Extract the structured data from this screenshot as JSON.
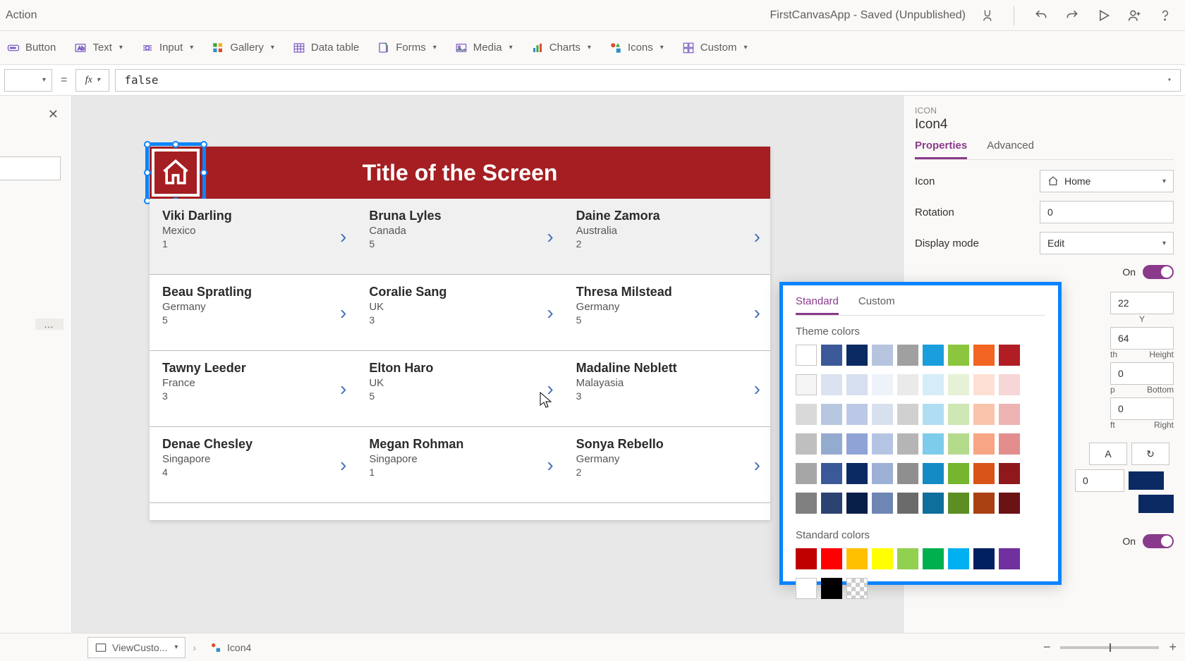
{
  "titlebar": {
    "action_label": "Action",
    "center_title": "FirstCanvasApp - Saved (Unpublished)"
  },
  "ribbon": {
    "button": "Button",
    "text": "Text",
    "input": "Input",
    "gallery": "Gallery",
    "datatable": "Data table",
    "forms": "Forms",
    "media": "Media",
    "charts": "Charts",
    "icons": "Icons",
    "custom": "Custom"
  },
  "formula": {
    "eq": "=",
    "fx": "fx",
    "value": "false"
  },
  "canvas": {
    "title": "Title of the Screen"
  },
  "gallery": [
    [
      {
        "name": "Viki Darling",
        "country": "Mexico",
        "num": "1"
      },
      {
        "name": "Bruna Lyles",
        "country": "Canada",
        "num": "5"
      },
      {
        "name": "Daine Zamora",
        "country": "Australia",
        "num": "2"
      }
    ],
    [
      {
        "name": "Beau Spratling",
        "country": "Germany",
        "num": "5"
      },
      {
        "name": "Coralie Sang",
        "country": "UK",
        "num": "3"
      },
      {
        "name": "Thresa Milstead",
        "country": "Germany",
        "num": "5"
      }
    ],
    [
      {
        "name": "Tawny Leeder",
        "country": "France",
        "num": "3"
      },
      {
        "name": "Elton Haro",
        "country": "UK",
        "num": "5"
      },
      {
        "name": "Madaline Neblett",
        "country": "Malayasia",
        "num": "3"
      }
    ],
    [
      {
        "name": "Denae Chesley",
        "country": "Singapore",
        "num": "4"
      },
      {
        "name": "Megan Rohman",
        "country": "Singapore",
        "num": "1"
      },
      {
        "name": "Sonya Rebello",
        "country": "Germany",
        "num": "2"
      }
    ]
  ],
  "panel": {
    "category": "ICON",
    "name": "Icon4",
    "tabs": {
      "properties": "Properties",
      "advanced": "Advanced"
    },
    "rows": {
      "icon_label": "Icon",
      "icon_value": "Home",
      "rotation_label": "Rotation",
      "rotation_value": "0",
      "display_mode_label": "Display mode",
      "display_mode_value": "Edit",
      "on_label": "On",
      "y_label": "Y",
      "y_value": "64",
      "x_value": "22",
      "height_label": "Height",
      "height_value": "0",
      "width_label": "th",
      "bottom_label": "Bottom",
      "bottom_value": "0",
      "top_label": "p",
      "left_label": "ft",
      "right_label": "Right",
      "num_value": "0"
    }
  },
  "colorpicker": {
    "tabs": {
      "standard": "Standard",
      "custom": "Custom"
    },
    "theme_label": "Theme colors",
    "standard_label": "Standard colors",
    "theme_rows": [
      [
        "#ffffff",
        "#3b5998",
        "#0b2a63",
        "#b6c4de",
        "#a0a0a0",
        "#1a9edc",
        "#8cc63f",
        "#f26522",
        "#b01e23"
      ],
      [
        "#f5f5f5",
        "#dbe3f0",
        "#d6dff0",
        "#eef2f9",
        "#eaeaea",
        "#d5edf8",
        "#e6f2d5",
        "#fde0d3",
        "#f6d6d6"
      ],
      [
        "#d9d9d9",
        "#b8c7e0",
        "#bcc9e6",
        "#d8e0f0",
        "#d0d0d0",
        "#b0ddf2",
        "#cfe7b4",
        "#fac3ac",
        "#eeb3b3"
      ],
      [
        "#bfbfbf",
        "#94abd0",
        "#8fa3d6",
        "#b6c4e3",
        "#b5b5b5",
        "#7dcceb",
        "#b4da8c",
        "#f7a584",
        "#e38d8d"
      ],
      [
        "#a6a6a6",
        "#3b5998",
        "#0b2a63",
        "#9db0d6",
        "#8f8f8f",
        "#148bc4",
        "#76b52e",
        "#d95417",
        "#8f181c"
      ],
      [
        "#808080",
        "#2c4270",
        "#081f49",
        "#6f86b5",
        "#6b6b6b",
        "#0e6e9c",
        "#5c8e24",
        "#a94112",
        "#6b1215"
      ]
    ],
    "standard_rows": [
      [
        "#c00000",
        "#ff0000",
        "#ffc000",
        "#ffff00",
        "#92d050",
        "#00b050",
        "#00b0f0",
        "#002060",
        "#7030a0"
      ],
      [
        "#ffffff",
        "#000000",
        "transparent"
      ]
    ]
  },
  "status": {
    "crumb1": "ViewCusto...",
    "crumb2": "Icon4"
  }
}
